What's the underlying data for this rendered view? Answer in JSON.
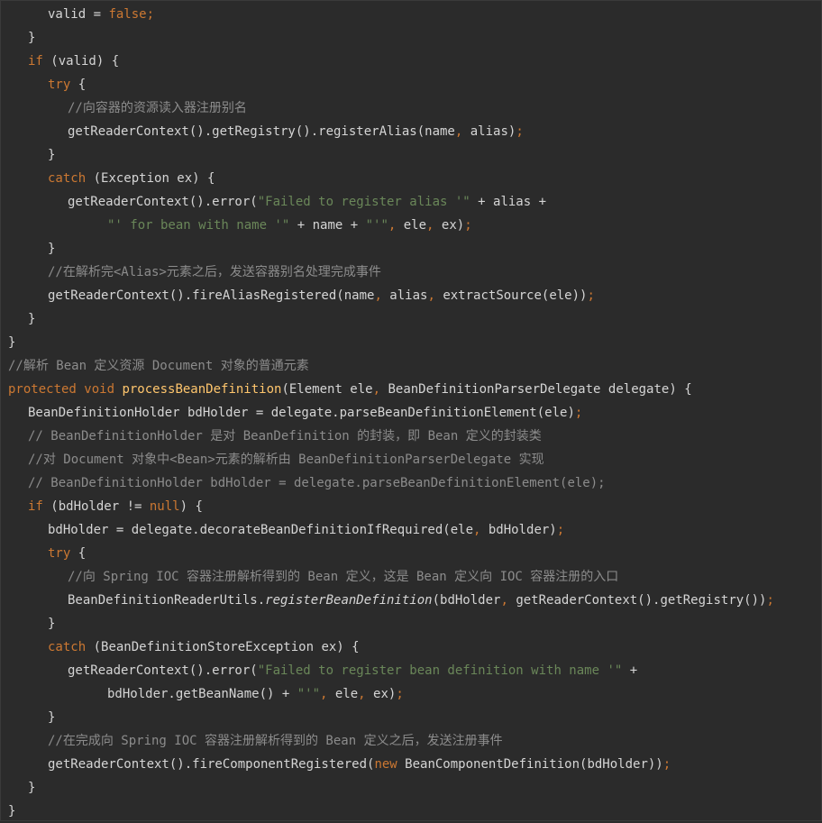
{
  "colors": {
    "background": "#2b2b2b",
    "keyword": "#cc7832",
    "string": "#6a8759",
    "comment": "#8c8c8c",
    "function": "#ffc66d",
    "plain": "#d5d5d5"
  },
  "code": {
    "lines": [
      {
        "indent": 2,
        "tokens": [
          {
            "t": "valid = ",
            "c": "pl"
          },
          {
            "t": "false",
            "c": "kw"
          },
          {
            "t": ";",
            "c": "kw"
          }
        ]
      },
      {
        "indent": 1,
        "tokens": [
          {
            "t": "}",
            "c": "pl"
          }
        ]
      },
      {
        "indent": 1,
        "tokens": [
          {
            "t": "if",
            "c": "kw"
          },
          {
            "t": " (valid) {",
            "c": "pl"
          }
        ]
      },
      {
        "indent": 2,
        "tokens": [
          {
            "t": "try",
            "c": "kw"
          },
          {
            "t": " {",
            "c": "pl"
          }
        ]
      },
      {
        "indent": 3,
        "tokens": [
          {
            "t": "//向容器的资源读入器注册别名",
            "c": "cm"
          }
        ]
      },
      {
        "indent": 3,
        "tokens": [
          {
            "t": "getReaderContext().getRegistry().registerAlias(name",
            "c": "pl"
          },
          {
            "t": ", ",
            "c": "kw"
          },
          {
            "t": "alias)",
            "c": "pl"
          },
          {
            "t": ";",
            "c": "kw"
          }
        ]
      },
      {
        "indent": 2,
        "tokens": [
          {
            "t": "}",
            "c": "pl"
          }
        ]
      },
      {
        "indent": 2,
        "tokens": [
          {
            "t": "catch",
            "c": "kw"
          },
          {
            "t": " (Exception ex) {",
            "c": "pl"
          }
        ]
      },
      {
        "indent": 3,
        "tokens": [
          {
            "t": "getReaderContext().error(",
            "c": "pl"
          },
          {
            "t": "\"Failed to register alias '\"",
            "c": "str"
          },
          {
            "t": " + alias +",
            "c": "pl"
          }
        ]
      },
      {
        "indent": 5,
        "tokens": [
          {
            "t": "\"' for bean with name '\"",
            "c": "str"
          },
          {
            "t": " + name + ",
            "c": "pl"
          },
          {
            "t": "\"'\"",
            "c": "str"
          },
          {
            "t": ", ",
            "c": "kw"
          },
          {
            "t": "ele",
            "c": "pl"
          },
          {
            "t": ", ",
            "c": "kw"
          },
          {
            "t": "ex)",
            "c": "pl"
          },
          {
            "t": ";",
            "c": "kw"
          }
        ]
      },
      {
        "indent": 2,
        "tokens": [
          {
            "t": "}",
            "c": "pl"
          }
        ]
      },
      {
        "indent": 2,
        "tokens": [
          {
            "t": "//在解析完<Alias>元素之后，发送容器别名处理完成事件",
            "c": "cm"
          }
        ]
      },
      {
        "indent": 2,
        "tokens": [
          {
            "t": "getReaderContext().fireAliasRegistered(name",
            "c": "pl"
          },
          {
            "t": ", ",
            "c": "kw"
          },
          {
            "t": "alias",
            "c": "pl"
          },
          {
            "t": ", ",
            "c": "kw"
          },
          {
            "t": "extractSource(ele))",
            "c": "pl"
          },
          {
            "t": ";",
            "c": "kw"
          }
        ]
      },
      {
        "indent": 1,
        "tokens": [
          {
            "t": "}",
            "c": "pl"
          }
        ]
      },
      {
        "indent": 0,
        "tokens": [
          {
            "t": "}",
            "c": "pl"
          }
        ]
      },
      {
        "indent": 0,
        "tokens": [
          {
            "t": "//解析 Bean 定义资源 Document 对象的普通元素",
            "c": "cm"
          }
        ]
      },
      {
        "indent": 0,
        "tokens": [
          {
            "t": "protected void ",
            "c": "kw"
          },
          {
            "t": "processBeanDefinition",
            "c": "fn"
          },
          {
            "t": "(Element ele",
            "c": "pl"
          },
          {
            "t": ", ",
            "c": "kw"
          },
          {
            "t": "BeanDefinitionParserDelegate delegate) {",
            "c": "pl"
          }
        ]
      },
      {
        "indent": 1,
        "tokens": [
          {
            "t": "BeanDefinitionHolder bdHolder = delegate.parseBeanDefinitionElement(ele)",
            "c": "pl"
          },
          {
            "t": ";",
            "c": "kw"
          }
        ]
      },
      {
        "indent": 1,
        "tokens": [
          {
            "t": "// BeanDefinitionHolder 是对 BeanDefinition 的封装，即 Bean 定义的封装类",
            "c": "cm"
          }
        ]
      },
      {
        "indent": 1,
        "tokens": [
          {
            "t": "//对 Document 对象中<Bean>元素的解析由 BeanDefinitionParserDelegate 实现",
            "c": "cm"
          }
        ]
      },
      {
        "indent": 1,
        "tokens": [
          {
            "t": "// BeanDefinitionHolder bdHolder = delegate.parseBeanDefinitionElement(ele);",
            "c": "cm"
          }
        ]
      },
      {
        "indent": 1,
        "tokens": [
          {
            "t": "if",
            "c": "kw"
          },
          {
            "t": " (bdHolder != ",
            "c": "pl"
          },
          {
            "t": "null",
            "c": "kw"
          },
          {
            "t": ") {",
            "c": "pl"
          }
        ]
      },
      {
        "indent": 2,
        "tokens": [
          {
            "t": "bdHolder = delegate.decorateBeanDefinitionIfRequired(ele",
            "c": "pl"
          },
          {
            "t": ", ",
            "c": "kw"
          },
          {
            "t": "bdHolder)",
            "c": "pl"
          },
          {
            "t": ";",
            "c": "kw"
          }
        ]
      },
      {
        "indent": 2,
        "tokens": [
          {
            "t": "try",
            "c": "kw"
          },
          {
            "t": " {",
            "c": "pl"
          }
        ]
      },
      {
        "indent": 3,
        "tokens": [
          {
            "t": "//向 Spring IOC 容器注册解析得到的 Bean 定义，这是 Bean 定义向 IOC 容器注册的入口",
            "c": "cm"
          }
        ]
      },
      {
        "indent": 3,
        "tokens": [
          {
            "t": "BeanDefinitionReaderUtils.",
            "c": "pl"
          },
          {
            "t": "registerBeanDefinition",
            "c": "pl it"
          },
          {
            "t": "(bdHolder",
            "c": "pl"
          },
          {
            "t": ", ",
            "c": "kw"
          },
          {
            "t": "getReaderContext().getRegistry())",
            "c": "pl"
          },
          {
            "t": ";",
            "c": "kw"
          }
        ]
      },
      {
        "indent": 2,
        "tokens": [
          {
            "t": "}",
            "c": "pl"
          }
        ]
      },
      {
        "indent": 2,
        "tokens": [
          {
            "t": "catch",
            "c": "kw"
          },
          {
            "t": " (BeanDefinitionStoreException ex) {",
            "c": "pl"
          }
        ]
      },
      {
        "indent": 3,
        "tokens": [
          {
            "t": "getReaderContext().error(",
            "c": "pl"
          },
          {
            "t": "\"Failed to register bean definition with name '\"",
            "c": "str"
          },
          {
            "t": " +",
            "c": "pl"
          }
        ]
      },
      {
        "indent": 5,
        "tokens": [
          {
            "t": "bdHolder.getBeanName() + ",
            "c": "pl"
          },
          {
            "t": "\"'\"",
            "c": "str"
          },
          {
            "t": ", ",
            "c": "kw"
          },
          {
            "t": "ele",
            "c": "pl"
          },
          {
            "t": ", ",
            "c": "kw"
          },
          {
            "t": "ex)",
            "c": "pl"
          },
          {
            "t": ";",
            "c": "kw"
          }
        ]
      },
      {
        "indent": 2,
        "tokens": [
          {
            "t": "}",
            "c": "pl"
          }
        ]
      },
      {
        "indent": 2,
        "tokens": [
          {
            "t": "//在完成向 Spring IOC 容器注册解析得到的 Bean 定义之后，发送注册事件",
            "c": "cm"
          }
        ]
      },
      {
        "indent": 2,
        "tokens": [
          {
            "t": "getReaderContext().fireComponentRegistered(",
            "c": "pl"
          },
          {
            "t": "new ",
            "c": "kw"
          },
          {
            "t": "BeanComponentDefinition(bdHolder))",
            "c": "pl"
          },
          {
            "t": ";",
            "c": "kw"
          }
        ]
      },
      {
        "indent": 1,
        "tokens": [
          {
            "t": "}",
            "c": "pl"
          }
        ]
      },
      {
        "indent": 0,
        "tokens": [
          {
            "t": "}",
            "c": "pl"
          }
        ]
      }
    ]
  }
}
